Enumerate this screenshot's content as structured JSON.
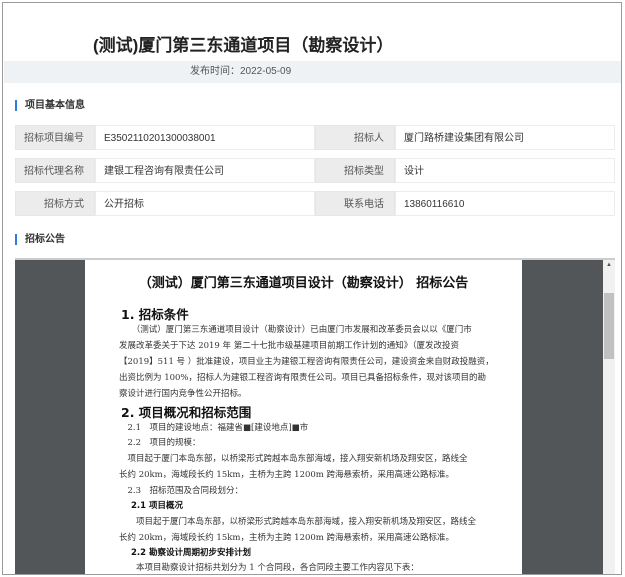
{
  "title": "(测试)厦门第三东通道项目（勘察设计）",
  "publish_label": "发布时间：2022-05-09",
  "sections": {
    "basic": "项目基本信息",
    "notice": "招标公告"
  },
  "info": [
    [
      "招标项目编号",
      "E3502110201300038001",
      "招标人",
      "厦门路桥建设集团有限公司"
    ],
    [
      "招标代理名称",
      "建银工程咨询有限责任公司",
      "招标类型",
      "设计"
    ],
    [
      "招标方式",
      "公开招标",
      "联系电话",
      "13860116610"
    ]
  ],
  "doc": {
    "title": "（测试）厦门第三东通道项目设计（勘察设计）  招标公告",
    "h1a": "1. 招标条件",
    "p1": [
      "　　（测试）厦门第三东通道项目设计（勘察设计）已由厦门市发展和改革委员会以以《厦门市",
      "发展改革委关于下达 2019 年 第二十七批市级基建项目前期工作计划的通知》（厦发改投资",
      "【2019】511 号 ）批准建设，项目业主为建银工程咨询有限责任公司，建设资金来自财政投融资，",
      "出资比例为 100%，招标人为建银工程咨询有限责任公司。项目已具备招标条件，现对该项目的勘",
      "察设计进行国内竞争性公开招标。"
    ],
    "h1b": "2. 项目概况和招标范围",
    "p2": [
      "　2.1　项目的建设地点：福建省■[建设地点]■市",
      "　2.2　项目的规模：",
      "　项目起于厦门本岛东部，以桥梁形式跨越本岛东部海域，接入翔安新机场及翔安区，路线全",
      "长约 20km，海域段长约 15km，主桥为主跨 1200m 跨海悬索桥，采用高速公路标准。",
      "　2.3　招标范围及合同段划分："
    ],
    "h2a": "2.1 项目概况",
    "p3": [
      "　　项目起于厦门本岛东部，以桥梁形式跨越本岛东部海域，接入翔安新机场及翔安区，路线全",
      "长约 20km，海域段长约 15km，主桥为主跨 1200m 跨海悬索桥，采用高速公路标准。"
    ],
    "h2b": "2.2 勘察设计周期初步安排计划",
    "p4": "　　本项目勘察设计招标共划分为 1 个合同段，各合同段主要工作内容见下表："
  }
}
